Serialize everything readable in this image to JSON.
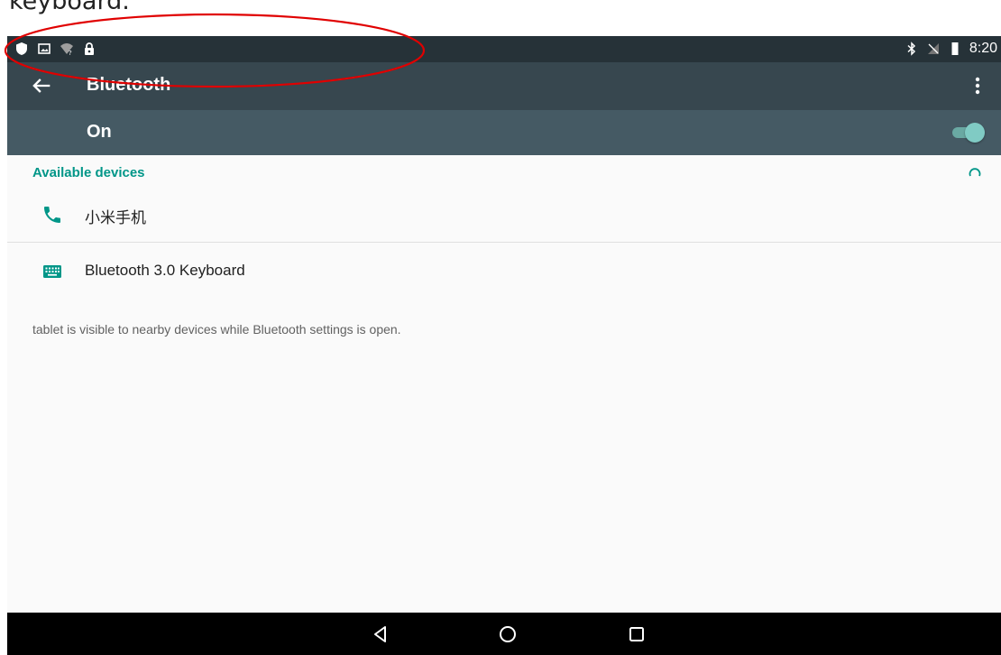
{
  "caption": "keyboard.",
  "status_bar": {
    "time": "8:20",
    "left_icons": [
      "shield-icon",
      "gallery-icon",
      "wifi-unknown-icon",
      "lock-icon"
    ],
    "right_icons": [
      "bluetooth-icon",
      "no-signal-icon",
      "battery-icon"
    ]
  },
  "app_bar": {
    "title": "Bluetooth",
    "back_icon": "arrow-back-icon",
    "menu_icon": "more-vert-icon"
  },
  "master_switch": {
    "label": "On",
    "state": true
  },
  "section": {
    "title": "Available devices",
    "scanning": true
  },
  "devices": [
    {
      "name": "小米手机",
      "icon": "phone-icon"
    },
    {
      "name": "Bluetooth 3.0 Keyboard",
      "icon": "keyboard-icon"
    }
  ],
  "footnote": "tablet is visible to nearby devices while Bluetooth settings is open.",
  "nav_bar": {
    "buttons": [
      "back-triangle-icon",
      "home-circle-icon",
      "recents-square-icon"
    ]
  },
  "colors": {
    "status_bar": "#263238",
    "app_bar": "#37474f",
    "switch_bar": "#455a64",
    "accent": "#009688",
    "annotation": "#e00000"
  }
}
